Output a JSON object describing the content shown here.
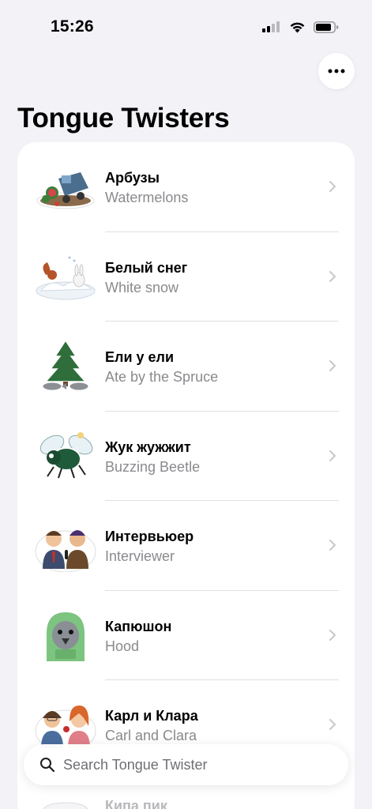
{
  "status_bar": {
    "time": "15:26",
    "icons": [
      "cellular-signal-icon",
      "wifi-icon",
      "battery-icon"
    ]
  },
  "header": {
    "title": "Tongue Twisters",
    "more_icon": "ellipsis-icon"
  },
  "list": {
    "items": [
      {
        "title": "Арбузы",
        "subtitle": "Watermelons",
        "icon": "watermelon-truck-illustration"
      },
      {
        "title": "Белый снег",
        "subtitle": "White snow",
        "icon": "squirrel-hare-snow-illustration"
      },
      {
        "title": "Ели у ели",
        "subtitle": "Ate by the Spruce",
        "icon": "spruce-fish-illustration"
      },
      {
        "title": "Жук жужжит",
        "subtitle": "Buzzing Beetle",
        "icon": "beetle-illustration"
      },
      {
        "title": "Интервьюер",
        "subtitle": "Interviewer",
        "icon": "interviewers-illustration"
      },
      {
        "title": "Капюшон",
        "subtitle": "Hood",
        "icon": "hooded-bird-illustration"
      },
      {
        "title": "Карл и Клара",
        "subtitle": "Carl and Clara",
        "icon": "carl-clara-illustration"
      },
      {
        "title": "Кипа пик",
        "subtitle": "",
        "icon": "pile-of-pikes-illustration"
      }
    ],
    "chevron_icon": "chevron-right-icon"
  },
  "search": {
    "placeholder": "Search Tongue Twister",
    "value": "",
    "icon": "search-icon"
  },
  "colors": {
    "background": "#f2f2f7",
    "card": "#ffffff",
    "secondary_text": "#8a8a8e",
    "chevron": "#c7c7cc"
  }
}
